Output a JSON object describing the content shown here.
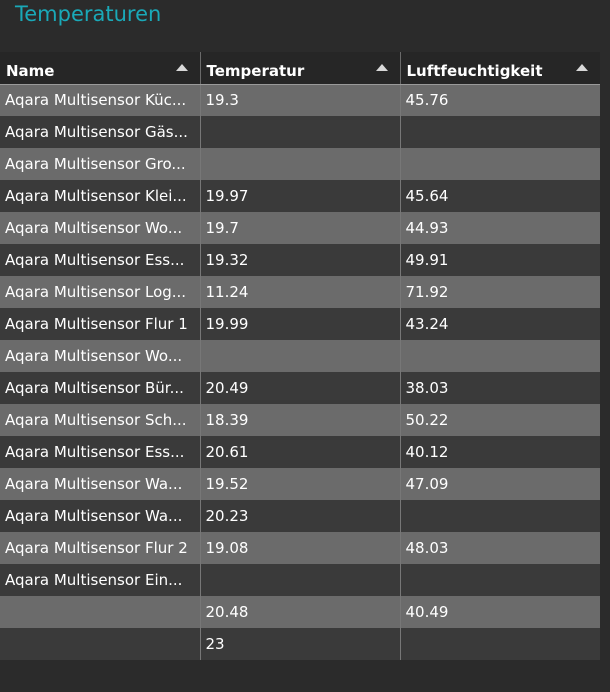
{
  "title": "Temperaturen",
  "columns": [
    "Name",
    "Temperatur",
    "Luftfeuchtigkeit"
  ],
  "rows": [
    [
      "Aqara Multisensor Küc...",
      "19.3",
      "45.76"
    ],
    [
      "Aqara Multisensor Gäs...",
      "",
      ""
    ],
    [
      "Aqara Multisensor Gro...",
      "",
      ""
    ],
    [
      "Aqara Multisensor Klei...",
      "19.97",
      "45.64"
    ],
    [
      "Aqara Multisensor Wo...",
      "19.7",
      "44.93"
    ],
    [
      "Aqara Multisensor Ess...",
      "19.32",
      "49.91"
    ],
    [
      "Aqara Multisensor Log...",
      "11.24",
      "71.92"
    ],
    [
      "Aqara Multisensor Flur 1",
      "19.99",
      "43.24"
    ],
    [
      "Aqara Multisensor Wo...",
      "",
      ""
    ],
    [
      "Aqara Multisensor Bür...",
      "20.49",
      "38.03"
    ],
    [
      "Aqara Multisensor Sch...",
      "18.39",
      "50.22"
    ],
    [
      "Aqara Multisensor Ess...",
      "20.61",
      "40.12"
    ],
    [
      "Aqara Multisensor Wa...",
      "19.52",
      "47.09"
    ],
    [
      "Aqara Multisensor Wa...",
      "20.23",
      ""
    ],
    [
      "Aqara Multisensor Flur 2",
      "19.08",
      "48.03"
    ],
    [
      "Aqara Multisensor Ein...",
      "",
      ""
    ],
    [
      "",
      "20.48",
      "40.49"
    ],
    [
      "",
      "23",
      ""
    ]
  ],
  "colors": {
    "title": "#1aa9b8",
    "row_light": "#6b6b6b",
    "row_dark": "#3a3a3a",
    "background": "#2b2b2b"
  }
}
